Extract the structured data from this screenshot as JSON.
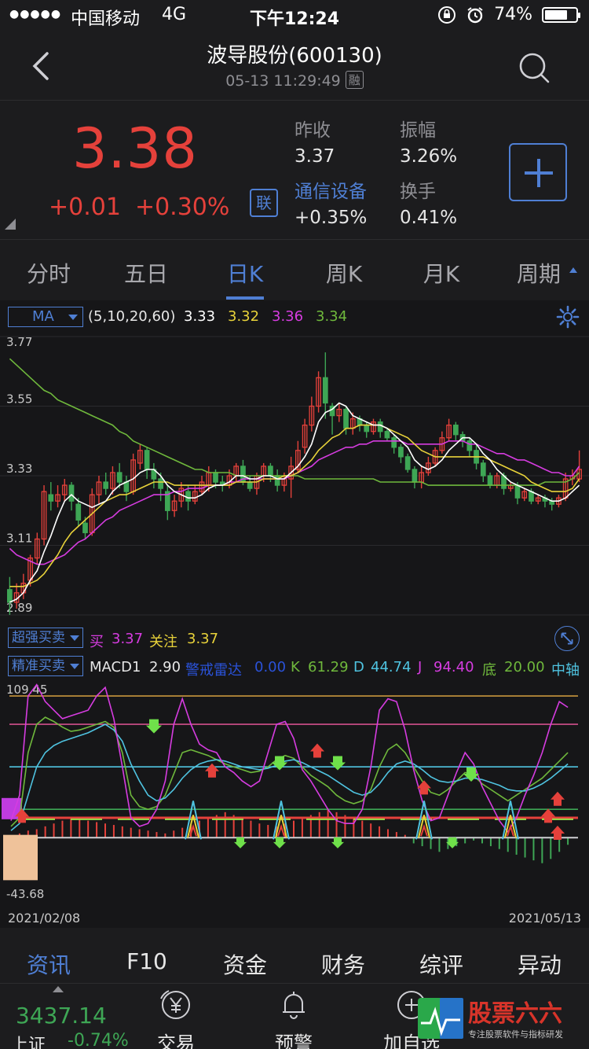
{
  "status_bar": {
    "signal": "●●●●●",
    "carrier": "中国移动",
    "network": "4G",
    "time": "下午12:24",
    "battery_pct": "74%",
    "battery_level": 0.74
  },
  "header": {
    "title": "波导股份(600130)",
    "datetime": "05-13 11:29:49",
    "badge": "融"
  },
  "quote": {
    "price": "3.38",
    "change": "+0.01",
    "change_pct": "+0.30%",
    "lian_badge": "联",
    "prev_close_label": "昨收",
    "prev_close": "3.37",
    "amplitude_label": "振幅",
    "amplitude": "3.26%",
    "sector_label": "通信设备",
    "sector_change": "+0.35%",
    "turnover_label": "换手",
    "turnover": "0.41%"
  },
  "tabs": [
    {
      "label": "分时"
    },
    {
      "label": "五日"
    },
    {
      "label": "日K",
      "active": true
    },
    {
      "label": "周K"
    },
    {
      "label": "月K"
    },
    {
      "label": "周期"
    }
  ],
  "ma_bar": {
    "selector": "MA",
    "params": "(5,10,20,60)",
    "values": [
      "3.33",
      "3.32",
      "3.36",
      "3.34"
    ],
    "colors": [
      "#ffffff",
      "#e8d23a",
      "#d63ce0",
      "#6fb83c"
    ]
  },
  "indicator_bar": {
    "selector": "超强买卖",
    "buy_label": "买",
    "buy_value": "3.37",
    "watch_label": "关注",
    "watch_value": "3.37"
  },
  "macd_bar": {
    "selector": "精准买卖",
    "macd_label": "MACD1",
    "macd_value": "2.90",
    "radar_label": "警戒雷达",
    "radar_value": "0.00",
    "k_label": "K",
    "k_value": "61.29",
    "d_label": "D",
    "d_value": "44.74",
    "j_label": "J",
    "j_value": "94.40",
    "bottom_label": "底",
    "bottom_value": "20.00",
    "axis_label": "中轴"
  },
  "chart_data": [
    {
      "type": "candlestick",
      "title": "",
      "y_ticks": [
        "3.77",
        "3.55",
        "3.33",
        "3.11",
        "2.89"
      ],
      "ylim": [
        2.89,
        3.77
      ],
      "x_start": "2021/02/08",
      "x_end": "2021/05/13",
      "ohlc": [
        [
          2.97,
          2.93,
          3.01,
          2.89
        ],
        [
          2.93,
          2.96,
          2.99,
          2.91
        ],
        [
          2.96,
          2.99,
          3.02,
          2.94
        ],
        [
          3.0,
          3.07,
          3.08,
          2.98
        ],
        [
          3.07,
          3.13,
          3.15,
          3.05
        ],
        [
          3.13,
          3.28,
          3.3,
          3.11
        ],
        [
          3.27,
          3.25,
          3.31,
          3.22
        ],
        [
          3.25,
          3.27,
          3.3,
          3.23
        ],
        [
          3.27,
          3.3,
          3.32,
          3.25
        ],
        [
          3.3,
          3.25,
          3.31,
          3.22
        ],
        [
          3.24,
          3.19,
          3.26,
          3.17
        ],
        [
          3.18,
          3.15,
          3.2,
          3.13
        ],
        [
          3.15,
          3.27,
          3.29,
          3.14
        ],
        [
          3.27,
          3.31,
          3.33,
          3.24
        ],
        [
          3.31,
          3.29,
          3.34,
          3.27
        ],
        [
          3.29,
          3.34,
          3.36,
          3.27
        ],
        [
          3.34,
          3.31,
          3.37,
          3.29
        ],
        [
          3.31,
          3.28,
          3.33,
          3.25
        ],
        [
          3.28,
          3.38,
          3.4,
          3.27
        ],
        [
          3.37,
          3.41,
          3.43,
          3.35
        ],
        [
          3.41,
          3.35,
          3.42,
          3.32
        ],
        [
          3.35,
          3.32,
          3.37,
          3.29
        ],
        [
          3.32,
          3.29,
          3.34,
          3.25
        ],
        [
          3.28,
          3.22,
          3.3,
          3.19
        ],
        [
          3.22,
          3.25,
          3.27,
          3.2
        ],
        [
          3.25,
          3.29,
          3.31,
          3.23
        ],
        [
          3.28,
          3.25,
          3.3,
          3.22
        ],
        [
          3.25,
          3.28,
          3.3,
          3.24
        ],
        [
          3.28,
          3.31,
          3.33,
          3.27
        ],
        [
          3.3,
          3.34,
          3.36,
          3.28
        ],
        [
          3.34,
          3.31,
          3.35,
          3.29
        ],
        [
          3.31,
          3.3,
          3.33,
          3.28
        ],
        [
          3.3,
          3.33,
          3.35,
          3.29
        ],
        [
          3.33,
          3.36,
          3.37,
          3.31
        ],
        [
          3.36,
          3.31,
          3.38,
          3.3
        ],
        [
          3.31,
          3.29,
          3.33,
          3.28
        ],
        [
          3.29,
          3.33,
          3.34,
          3.27
        ],
        [
          3.33,
          3.36,
          3.37,
          3.31
        ],
        [
          3.36,
          3.33,
          3.37,
          3.31
        ],
        [
          3.33,
          3.3,
          3.35,
          3.28
        ],
        [
          3.3,
          3.32,
          3.34,
          3.28
        ],
        [
          3.32,
          3.36,
          3.39,
          3.26
        ],
        [
          3.35,
          3.41,
          3.44,
          3.34
        ],
        [
          3.42,
          3.49,
          3.51,
          3.4
        ],
        [
          3.49,
          3.55,
          3.58,
          3.47
        ],
        [
          3.55,
          3.64,
          3.66,
          3.53
        ],
        [
          3.64,
          3.56,
          3.72,
          3.51
        ],
        [
          3.55,
          3.52,
          3.56,
          3.46
        ],
        [
          3.52,
          3.54,
          3.56,
          3.5
        ],
        [
          3.54,
          3.48,
          3.55,
          3.46
        ],
        [
          3.48,
          3.51,
          3.53,
          3.46
        ],
        [
          3.51,
          3.49,
          3.52,
          3.47
        ],
        [
          3.49,
          3.47,
          3.5,
          3.45
        ],
        [
          3.47,
          3.5,
          3.51,
          3.46
        ],
        [
          3.5,
          3.47,
          3.51,
          3.45
        ],
        [
          3.47,
          3.45,
          3.48,
          3.44
        ],
        [
          3.45,
          3.42,
          3.46,
          3.4
        ],
        [
          3.42,
          3.39,
          3.43,
          3.37
        ],
        [
          3.39,
          3.35,
          3.4,
          3.34
        ],
        [
          3.35,
          3.31,
          3.36,
          3.29
        ],
        [
          3.31,
          3.34,
          3.36,
          3.29
        ],
        [
          3.34,
          3.37,
          3.39,
          3.33
        ],
        [
          3.37,
          3.41,
          3.42,
          3.36
        ],
        [
          3.41,
          3.45,
          3.47,
          3.4
        ],
        [
          3.45,
          3.49,
          3.51,
          3.44
        ],
        [
          3.49,
          3.46,
          3.5,
          3.44
        ],
        [
          3.46,
          3.44,
          3.47,
          3.42
        ],
        [
          3.44,
          3.41,
          3.45,
          3.39
        ],
        [
          3.41,
          3.37,
          3.43,
          3.35
        ],
        [
          3.37,
          3.33,
          3.38,
          3.31
        ],
        [
          3.33,
          3.3,
          3.34,
          3.29
        ],
        [
          3.3,
          3.33,
          3.34,
          3.29
        ],
        [
          3.33,
          3.29,
          3.34,
          3.27
        ],
        [
          3.29,
          3.3,
          3.31,
          3.28
        ],
        [
          3.3,
          3.26,
          3.31,
          3.24
        ],
        [
          3.26,
          3.28,
          3.29,
          3.25
        ],
        [
          3.28,
          3.25,
          3.29,
          3.24
        ],
        [
          3.25,
          3.26,
          3.27,
          3.24
        ],
        [
          3.26,
          3.25,
          3.27,
          3.23
        ],
        [
          3.25,
          3.24,
          3.26,
          3.22
        ],
        [
          3.24,
          3.26,
          3.27,
          3.23
        ],
        [
          3.26,
          3.32,
          3.34,
          3.25
        ],
        [
          3.32,
          3.33,
          3.35,
          3.3
        ],
        [
          3.32,
          3.35,
          3.41,
          3.31
        ]
      ],
      "ma5": [
        2.93,
        2.94,
        2.96,
        3.0,
        3.03,
        3.09,
        3.14,
        3.2,
        3.25,
        3.27,
        3.25,
        3.24,
        3.23,
        3.24,
        3.25,
        3.28,
        3.3,
        3.31,
        3.32,
        3.34,
        3.35,
        3.35,
        3.33,
        3.3,
        3.28,
        3.27,
        3.26,
        3.26,
        3.27,
        3.29,
        3.3,
        3.3,
        3.31,
        3.33,
        3.33,
        3.32,
        3.32,
        3.33,
        3.33,
        3.32,
        3.32,
        3.34,
        3.36,
        3.39,
        3.43,
        3.5,
        3.53,
        3.54,
        3.56,
        3.55,
        3.52,
        3.51,
        3.5,
        3.49,
        3.49,
        3.48,
        3.46,
        3.44,
        3.42,
        3.38,
        3.36,
        3.35,
        3.36,
        3.38,
        3.41,
        3.43,
        3.45,
        3.45,
        3.43,
        3.4,
        3.38,
        3.35,
        3.33,
        3.31,
        3.3,
        3.29,
        3.28,
        3.27,
        3.26,
        3.25,
        3.25,
        3.26,
        3.28,
        3.3
      ],
      "ma10": [
        2.98,
        2.98,
        2.98,
        2.99,
        3.0,
        3.02,
        3.05,
        3.08,
        3.12,
        3.15,
        3.17,
        3.19,
        3.21,
        3.23,
        3.25,
        3.26,
        3.27,
        3.27,
        3.28,
        3.29,
        3.3,
        3.31,
        3.31,
        3.31,
        3.3,
        3.3,
        3.3,
        3.3,
        3.3,
        3.3,
        3.3,
        3.3,
        3.3,
        3.31,
        3.31,
        3.31,
        3.31,
        3.32,
        3.32,
        3.32,
        3.33,
        3.33,
        3.34,
        3.36,
        3.38,
        3.41,
        3.43,
        3.45,
        3.46,
        3.48,
        3.48,
        3.49,
        3.49,
        3.49,
        3.49,
        3.48,
        3.47,
        3.46,
        3.45,
        3.43,
        3.41,
        3.4,
        3.39,
        3.39,
        3.39,
        3.39,
        3.39,
        3.39,
        3.39,
        3.39,
        3.38,
        3.37,
        3.36,
        3.35,
        3.34,
        3.33,
        3.31,
        3.3,
        3.29,
        3.28,
        3.28,
        3.28,
        3.29,
        3.32
      ],
      "ma20": [
        3.1,
        3.08,
        3.07,
        3.06,
        3.05,
        3.05,
        3.06,
        3.07,
        3.08,
        3.1,
        3.12,
        3.13,
        3.15,
        3.17,
        3.19,
        3.2,
        3.22,
        3.23,
        3.24,
        3.25,
        3.26,
        3.27,
        3.27,
        3.27,
        3.28,
        3.28,
        3.29,
        3.29,
        3.29,
        3.3,
        3.3,
        3.3,
        3.31,
        3.31,
        3.32,
        3.32,
        3.32,
        3.32,
        3.32,
        3.32,
        3.32,
        3.33,
        3.34,
        3.35,
        3.36,
        3.38,
        3.39,
        3.4,
        3.41,
        3.42,
        3.42,
        3.43,
        3.43,
        3.44,
        3.44,
        3.44,
        3.44,
        3.44,
        3.43,
        3.43,
        3.43,
        3.43,
        3.43,
        3.43,
        3.44,
        3.44,
        3.44,
        3.43,
        3.43,
        3.42,
        3.41,
        3.4,
        3.4,
        3.39,
        3.38,
        3.38,
        3.37,
        3.36,
        3.35,
        3.34,
        3.34,
        3.33,
        3.33,
        3.36
      ],
      "ma60": [
        3.7,
        3.68,
        3.66,
        3.64,
        3.62,
        3.6,
        3.59,
        3.57,
        3.56,
        3.55,
        3.54,
        3.53,
        3.52,
        3.51,
        3.5,
        3.49,
        3.47,
        3.46,
        3.44,
        3.43,
        3.42,
        3.41,
        3.4,
        3.39,
        3.38,
        3.37,
        3.36,
        3.35,
        3.35,
        3.34,
        3.34,
        3.34,
        3.34,
        3.33,
        3.33,
        3.33,
        3.33,
        3.33,
        3.33,
        3.33,
        3.33,
        3.33,
        3.33,
        3.32,
        3.32,
        3.32,
        3.32,
        3.32,
        3.32,
        3.32,
        3.32,
        3.32,
        3.32,
        3.32,
        3.31,
        3.31,
        3.31,
        3.31,
        3.31,
        3.31,
        3.31,
        3.3,
        3.3,
        3.3,
        3.3,
        3.3,
        3.3,
        3.3,
        3.3,
        3.3,
        3.3,
        3.3,
        3.3,
        3.3,
        3.3,
        3.3,
        3.3,
        3.3,
        3.31,
        3.31,
        3.31,
        3.31,
        3.32,
        3.34
      ]
    },
    {
      "type": "line",
      "title": "",
      "y_ticks": [
        "109.45",
        "-43.68"
      ],
      "ylim": [
        -43.68,
        109.45
      ],
      "series": [
        {
          "name": "K",
          "values": [
            8,
            14,
            60,
            80,
            85,
            82,
            78,
            75,
            76,
            78,
            80,
            82,
            78,
            60,
            30,
            22,
            20,
            22,
            30,
            45,
            60,
            62,
            60,
            58,
            55,
            52,
            50,
            48,
            46,
            47,
            50,
            55,
            58,
            56,
            50,
            44,
            40,
            36,
            30,
            26,
            24,
            26,
            34,
            50,
            62,
            66,
            60,
            50,
            40,
            32,
            30,
            34,
            40,
            46,
            44,
            38,
            34,
            30,
            26,
            30,
            34,
            38,
            42,
            48,
            54,
            60
          ]
        },
        {
          "name": "D",
          "values": [
            5,
            10,
            30,
            50,
            60,
            65,
            68,
            70,
            72,
            74,
            77,
            80,
            76,
            68,
            52,
            40,
            30,
            26,
            28,
            34,
            42,
            48,
            52,
            54,
            55,
            54,
            52,
            50,
            49,
            48,
            49,
            51,
            54,
            55,
            53,
            50,
            47,
            44,
            40,
            36,
            32,
            30,
            32,
            38,
            46,
            52,
            54,
            52,
            48,
            43,
            40,
            39,
            40,
            42,
            42,
            41,
            39,
            37,
            34,
            33,
            33,
            35,
            38,
            42,
            47,
            52
          ]
        },
        {
          "name": "J",
          "values": [
            12,
            30,
            100,
            108,
            96,
            90,
            84,
            86,
            88,
            90,
            100,
            106,
            84,
            50,
            14,
            8,
            10,
            20,
            40,
            80,
            98,
            80,
            66,
            62,
            60,
            50,
            46,
            40,
            36,
            40,
            60,
            80,
            82,
            70,
            48,
            40,
            30,
            20,
            12,
            10,
            10,
            20,
            50,
            90,
            98,
            96,
            76,
            48,
            26,
            12,
            14,
            30,
            46,
            60,
            52,
            36,
            24,
            12,
            4,
            14,
            30,
            44,
            60,
            80,
            96,
            92
          ]
        }
      ],
      "radar_value": "0.00",
      "k_value": "61.29",
      "d_value": "44.74",
      "j_value": "94.40"
    }
  ],
  "bottom_tabs": [
    {
      "label": "资讯",
      "active": true
    },
    {
      "label": "F10"
    },
    {
      "label": "资金"
    },
    {
      "label": "财务"
    },
    {
      "label": "综评"
    },
    {
      "label": "异动"
    }
  ],
  "bottom_bar": {
    "index_value": "3437.14",
    "index_name": "上证",
    "index_change": "-0.74%",
    "items": [
      {
        "label": "交易",
        "icon": "yen-circle-icon"
      },
      {
        "label": "预警",
        "icon": "bell-icon"
      },
      {
        "label": "加自选",
        "icon": "plus-circle-icon"
      }
    ]
  }
}
